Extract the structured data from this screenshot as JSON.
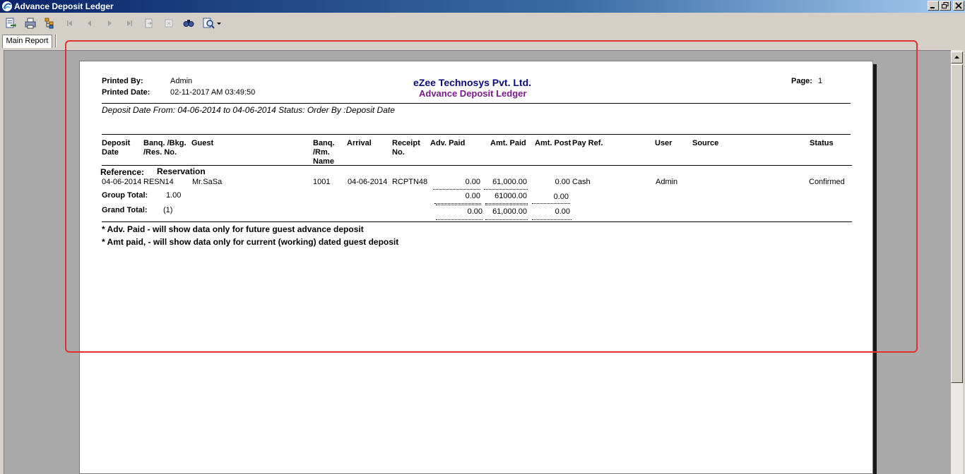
{
  "window": {
    "title": "Advance Deposit Ledger"
  },
  "toolbar": {
    "icons": [
      "export-icon",
      "print-icon",
      "group-tree-icon",
      "first-page-icon",
      "previous-page-icon",
      "next-page-icon",
      "last-page-icon",
      "goto-page-icon",
      "stop-icon",
      "search-icon",
      "zoom-icon"
    ]
  },
  "tabs": [
    "Main Report"
  ],
  "report": {
    "printed_by_label": "Printed By:",
    "printed_by": "Admin",
    "printed_date_label": "Printed Date:",
    "printed_date": "02-11-2017 AM 03:49:50",
    "company": "eZee Technosys Pvt. Ltd.",
    "title": "Advance Deposit Ledger",
    "page_label": "Page:",
    "page": "1",
    "filter": "Deposit Date From: 04-06-2014 to 04-06-2014  Status:    Order By :Deposit Date",
    "columns": {
      "deposit_date": [
        "Deposit",
        "Date"
      ],
      "banq_bkg": [
        "Banq. /Bkg.",
        "/Res. No."
      ],
      "guest": "Guest",
      "banq_rm": [
        "Banq.",
        "/Rm.",
        "Name"
      ],
      "arrival": "Arrival",
      "receipt": [
        "Receipt",
        "No."
      ],
      "adv_paid": "Adv. Paid",
      "amt_paid": "Amt. Paid",
      "amt_post": "Amt. Post",
      "pay_ref": "Pay Ref.",
      "user": "User",
      "source": "Source",
      "status": "Status"
    },
    "reference_label": "Reference:",
    "reference_value": "Reservation",
    "rows": [
      {
        "deposit_date": "04-06-2014",
        "res_no": "RESN14",
        "guest": "Mr.SaSa",
        "room": "1001",
        "arrival": "04-06-2014",
        "receipt": "RCPTN48",
        "adv_paid": "0.00",
        "amt_paid": "61,000.00",
        "amt_post": "0.00",
        "pay_ref": "Cash",
        "user": "Admin",
        "source": "",
        "status": "Confirmed"
      }
    ],
    "group_total_label": "Group Total:",
    "group_total_count": "1.00",
    "group_total_adv": "0.00",
    "group_total_amt": "61000.00",
    "group_total_post": "0.00",
    "grand_total_label": "Grand Total:",
    "grand_total_count": "(1)",
    "grand_total_adv": "0.00",
    "grand_total_amt": "61,000.00",
    "grand_total_post": "0.00",
    "notes": [
      "* Adv. Paid - will show data only for future guest advance deposit",
      "* Amt paid, - will show data only for current (working) dated guest deposit"
    ]
  },
  "colors": {
    "company": "#0a0a7a",
    "title": "#7a1a8a",
    "highlight": "#e53030"
  }
}
